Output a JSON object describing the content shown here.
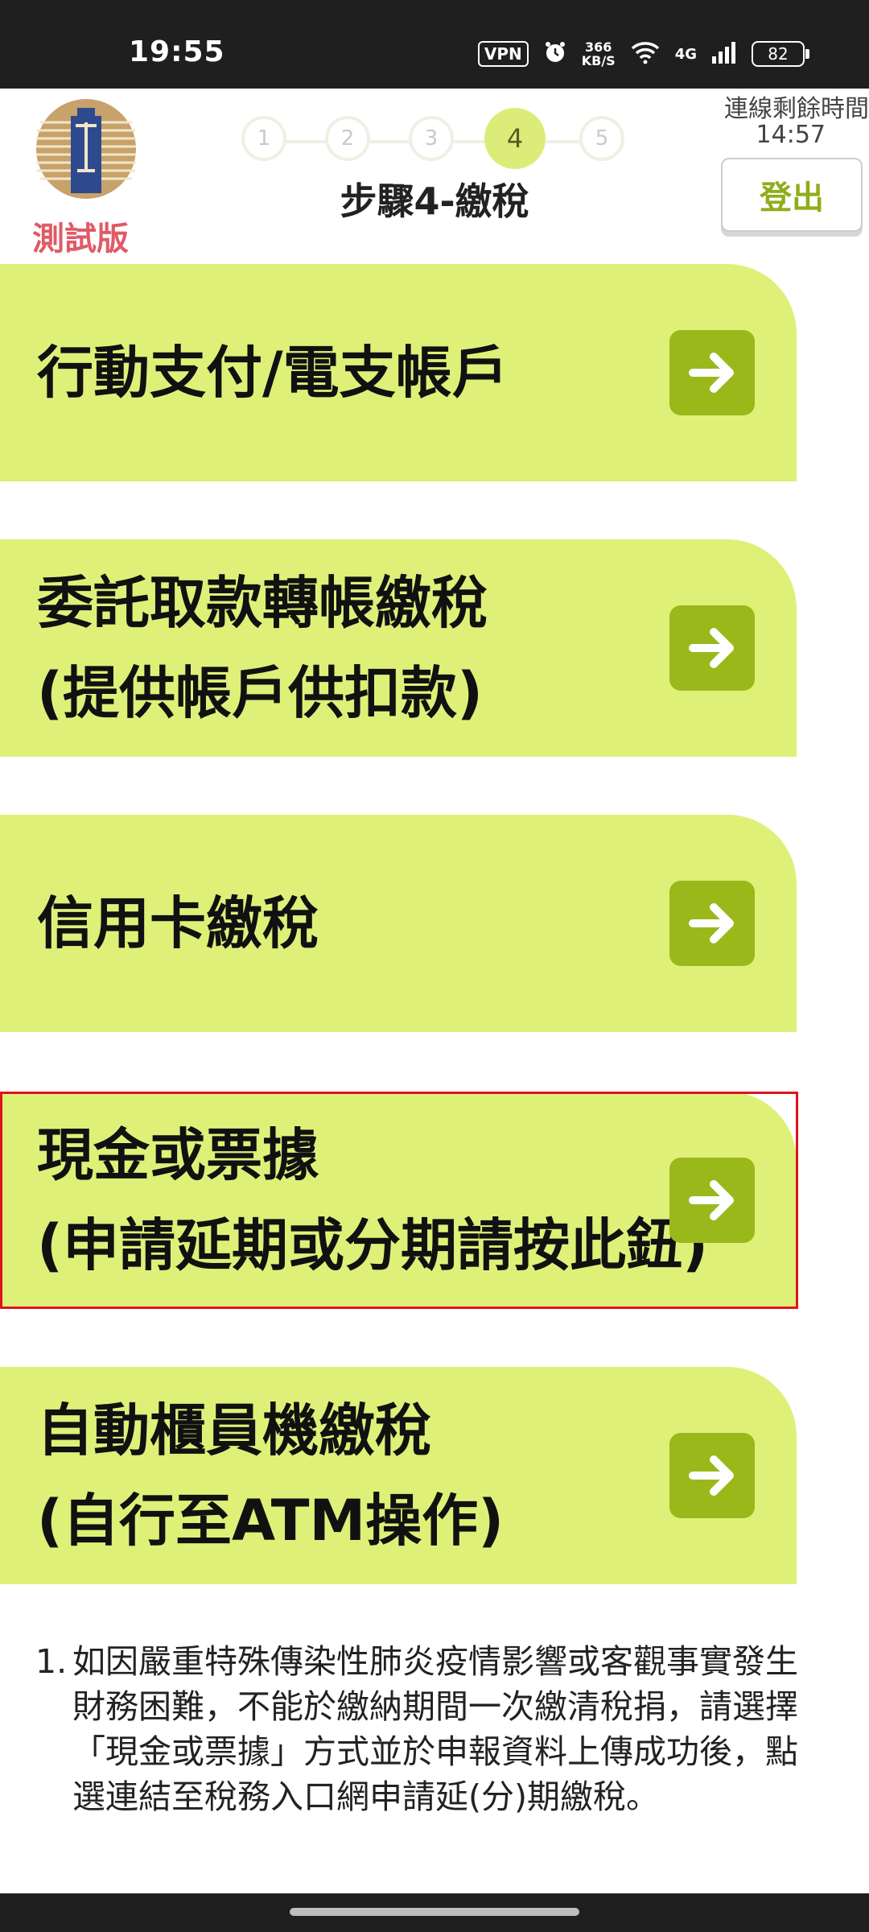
{
  "status_bar": {
    "time": "19:55",
    "vpn": "VPN",
    "speed_value": "366",
    "speed_unit": "KB/S",
    "network": "4G",
    "battery": "82",
    "icons": [
      "vpn-icon",
      "alarm-icon",
      "wifi-icon",
      "signal-icon",
      "battery-icon"
    ]
  },
  "header": {
    "test_label": "測試版",
    "steps": [
      "1",
      "2",
      "3",
      "4",
      "5"
    ],
    "active_step": "4",
    "step_title": "步驟4-繳稅",
    "session_label": "連線剩餘時間",
    "session_time": "14:57",
    "logout_label": "登出"
  },
  "options": [
    {
      "lines": [
        "行動支付/電支帳戶"
      ]
    },
    {
      "lines": [
        "委託取款轉帳繳稅",
        "(提供帳戶供扣款)"
      ]
    },
    {
      "lines": [
        "信用卡繳稅"
      ]
    },
    {
      "lines": [
        "現金或票據",
        "(申請延期或分期請按此鈕)"
      ]
    },
    {
      "lines": [
        "自動櫃員機繳稅",
        "(自行至ATM操作)"
      ]
    }
  ],
  "notes": [
    {
      "num": "1.",
      "text": "如因嚴重特殊傳染性肺炎疫情影響或客觀事實發生財務困難，不能於繳納期間一次繳清稅捐，請選擇「現金或票據」方式並於申報資料上傳成功後，點選連結至稅務入口網申請延(分)期繳稅。"
    }
  ],
  "colors": {
    "option_bg": "#dff079",
    "arrow_bg": "#9bb81b",
    "active_step": "#dcec79",
    "logout_text": "#8fad1a",
    "test_label": "#e05a66",
    "highlight_border": "#e0121c"
  }
}
